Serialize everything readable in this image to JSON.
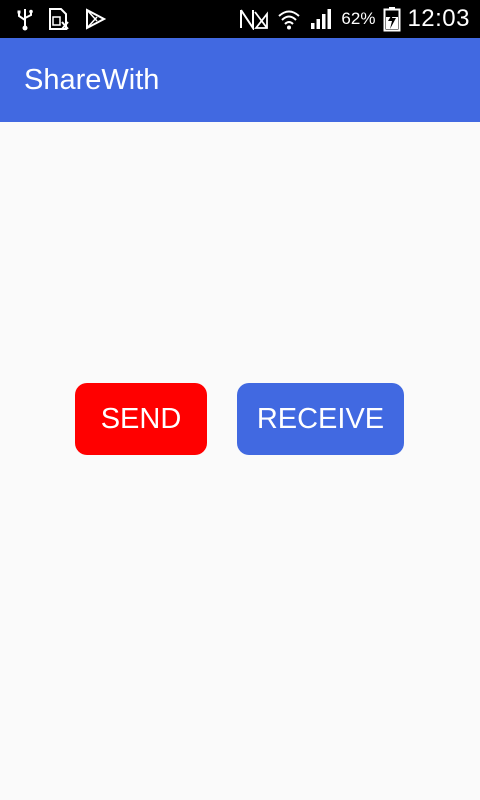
{
  "status_bar": {
    "left_icons": [
      "usb-icon",
      "sim-icon",
      "play-store-icon"
    ],
    "right_icons": [
      "no-sim-icon",
      "wifi-icon",
      "signal-icon"
    ],
    "battery_percent": "62%",
    "battery_icon": "battery-charging-icon",
    "time": "12:03"
  },
  "app_bar": {
    "title": "ShareWith",
    "color": "#4169e1"
  },
  "main": {
    "send_label": "SEND",
    "send_color": "#ff0000",
    "receive_label": "RECEIVE",
    "receive_color": "#4169e1"
  }
}
